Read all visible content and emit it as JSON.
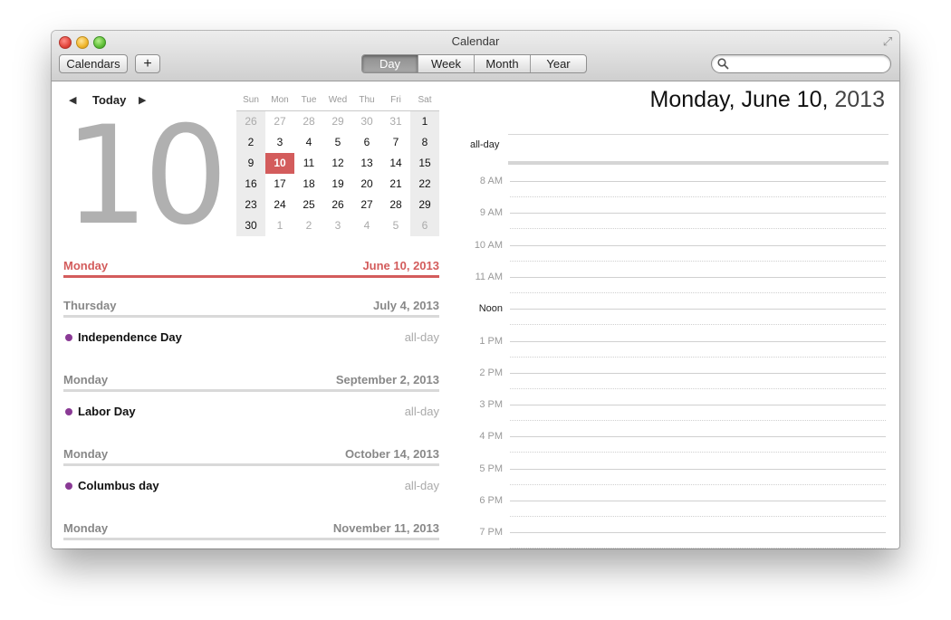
{
  "window": {
    "title": "Calendar"
  },
  "toolbar": {
    "calendars_label": "Calendars",
    "add_label": "+",
    "views": [
      "Day",
      "Week",
      "Month",
      "Year"
    ],
    "active_view": "Day",
    "search_placeholder": ""
  },
  "nav": {
    "prev": "◀",
    "today": "Today",
    "next": "▶"
  },
  "big_day": "10",
  "minical": {
    "weekdays": [
      "Sun",
      "Mon",
      "Tue",
      "Wed",
      "Thu",
      "Fri",
      "Sat"
    ],
    "weeks": [
      [
        "26",
        "27",
        "28",
        "29",
        "30",
        "31",
        "1"
      ],
      [
        "2",
        "3",
        "4",
        "5",
        "6",
        "7",
        "8"
      ],
      [
        "9",
        "10",
        "11",
        "12",
        "13",
        "14",
        "15"
      ],
      [
        "16",
        "17",
        "18",
        "19",
        "20",
        "21",
        "22"
      ],
      [
        "23",
        "24",
        "25",
        "26",
        "27",
        "28",
        "29"
      ],
      [
        "30",
        "1",
        "2",
        "3",
        "4",
        "5",
        "6"
      ]
    ],
    "today": "10"
  },
  "events": [
    {
      "day": "Monday",
      "date": "June 10, 2013",
      "current": true,
      "items": []
    },
    {
      "day": "Thursday",
      "date": "July 4, 2013",
      "current": false,
      "items": [
        {
          "name": "Independence Day",
          "time": "all-day"
        }
      ]
    },
    {
      "day": "Monday",
      "date": "September 2, 2013",
      "current": false,
      "items": [
        {
          "name": "Labor Day",
          "time": "all-day"
        }
      ]
    },
    {
      "day": "Monday",
      "date": "October 14, 2013",
      "current": false,
      "items": [
        {
          "name": "Columbus day",
          "time": "all-day"
        }
      ]
    },
    {
      "day": "Monday",
      "date": "November 11, 2013",
      "current": false,
      "items": []
    }
  ],
  "day_view": {
    "date_bold": "Monday, June 10,",
    "year": "2013",
    "allday_label": "all-day",
    "hours": [
      "8 AM",
      "9 AM",
      "10 AM",
      "11 AM",
      "Noon",
      "1 PM",
      "2 PM",
      "3 PM",
      "4 PM",
      "5 PM",
      "6 PM",
      "7 PM"
    ]
  },
  "colors": {
    "accent": "#d35c5c",
    "event_dot": "#8a3a95"
  }
}
